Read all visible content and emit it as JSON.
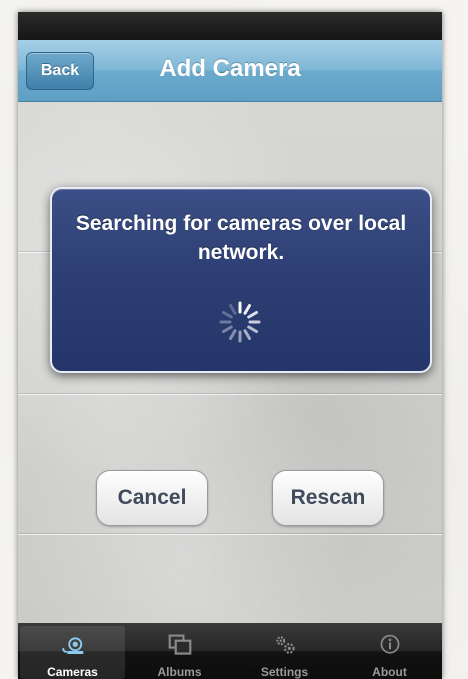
{
  "navbar": {
    "back_label": "Back",
    "title": "Add Camera"
  },
  "dialog": {
    "message": "Searching for cameras over local network."
  },
  "actions": {
    "cancel_label": "Cancel",
    "rescan_label": "Rescan"
  },
  "tabs": [
    {
      "label": "Cameras",
      "icon": "webcam-icon",
      "selected": true
    },
    {
      "label": "Albums",
      "icon": "albums-icon",
      "selected": false
    },
    {
      "label": "Settings",
      "icon": "gears-icon",
      "selected": false
    },
    {
      "label": "About",
      "icon": "info-icon",
      "selected": false
    }
  ],
  "colors": {
    "navbar": "#7fb7d6",
    "dialog": "#2d3f74",
    "tabbar": "#1a1a1a",
    "selected_icon": "#8ccaf0"
  }
}
